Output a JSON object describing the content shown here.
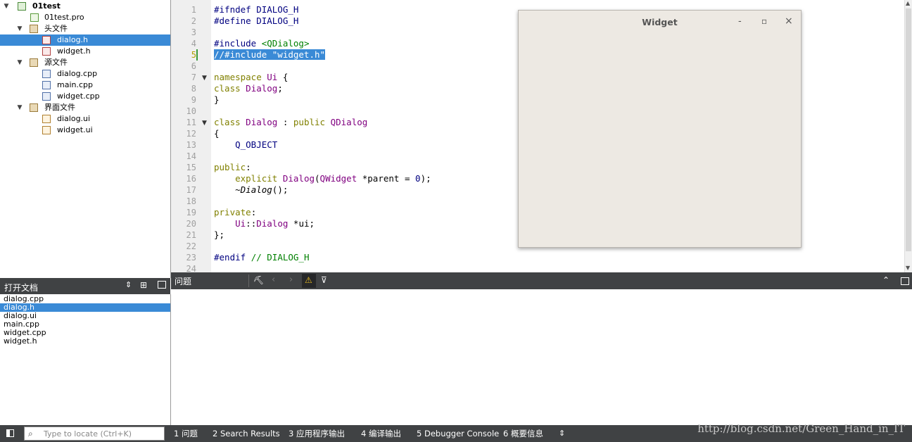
{
  "project_tree": [
    {
      "label": "01test",
      "icon": "project-icon",
      "arrow": "▼",
      "bold": true
    },
    {
      "label": "01test.pro",
      "icon": "pro-file-icon",
      "arrow": ""
    },
    {
      "label": "头文件",
      "icon": "header-folder-icon",
      "arrow": "▼"
    },
    {
      "label": "dialog.h",
      "icon": "header-file-icon",
      "arrow": "",
      "selected": true
    },
    {
      "label": "widget.h",
      "icon": "header-file-icon",
      "arrow": ""
    },
    {
      "label": "源文件",
      "icon": "source-folder-icon",
      "arrow": "▼"
    },
    {
      "label": "dialog.cpp",
      "icon": "cpp-file-icon",
      "arrow": ""
    },
    {
      "label": "main.cpp",
      "icon": "cpp-file-icon",
      "arrow": ""
    },
    {
      "label": "widget.cpp",
      "icon": "cpp-file-icon",
      "arrow": ""
    },
    {
      "label": "界面文件",
      "icon": "form-folder-icon",
      "arrow": "▼"
    },
    {
      "label": "dialog.ui",
      "icon": "ui-file-icon",
      "arrow": ""
    },
    {
      "label": "widget.ui",
      "icon": "ui-file-icon",
      "arrow": ""
    }
  ],
  "open_docs": {
    "title": "打开文档",
    "items": [
      "dialog.cpp",
      "dialog.h",
      "dialog.ui",
      "main.cpp",
      "widget.cpp",
      "widget.h"
    ],
    "selected_index": 1
  },
  "editor": {
    "current_line": 5,
    "line_numbers": [
      "1",
      "2",
      "3",
      "4",
      "5",
      "6",
      "7",
      "8",
      "9",
      "10",
      "11",
      "12",
      "13",
      "14",
      "15",
      "16",
      "17",
      "18",
      "19",
      "20",
      "21",
      "22",
      "23",
      "24"
    ],
    "lines": [
      "#ifndef DIALOG_H",
      "#define DIALOG_H",
      "",
      "#include <QDialog>",
      "//#include \"widget.h\"",
      "",
      "namespace Ui {",
      "class Dialog;",
      "}",
      "",
      "class Dialog : public QDialog",
      "{",
      "    Q_OBJECT",
      "",
      "public:",
      "    explicit Dialog(QWidget *parent = 0);",
      "    ~Dialog();",
      "",
      "private:",
      "    Ui::Dialog *ui;",
      "};",
      "",
      "#endif // DIALOG_H",
      ""
    ]
  },
  "widget_window": {
    "title": "Widget",
    "minimize": "-",
    "maximize": "▫",
    "close": "×"
  },
  "issues_panel": {
    "title": "问题"
  },
  "statusbar": {
    "locate_placeholder": "Type to locate (Ctrl+K)",
    "tabs": [
      {
        "num": "1",
        "label": "问题"
      },
      {
        "num": "2",
        "label": "Search Results"
      },
      {
        "num": "3",
        "label": "应用程序输出"
      },
      {
        "num": "4",
        "label": "编译输出"
      },
      {
        "num": "5",
        "label": "Debugger Console"
      },
      {
        "num": "6",
        "label": "概要信息"
      }
    ]
  },
  "watermark": "http://blog.csdn.net/Green_Hand_in_IT",
  "colors": {
    "selection": "#3a8ad6",
    "dark_bar": "#404244",
    "keyword": "#808000",
    "type": "#800080",
    "string": "#008000"
  }
}
